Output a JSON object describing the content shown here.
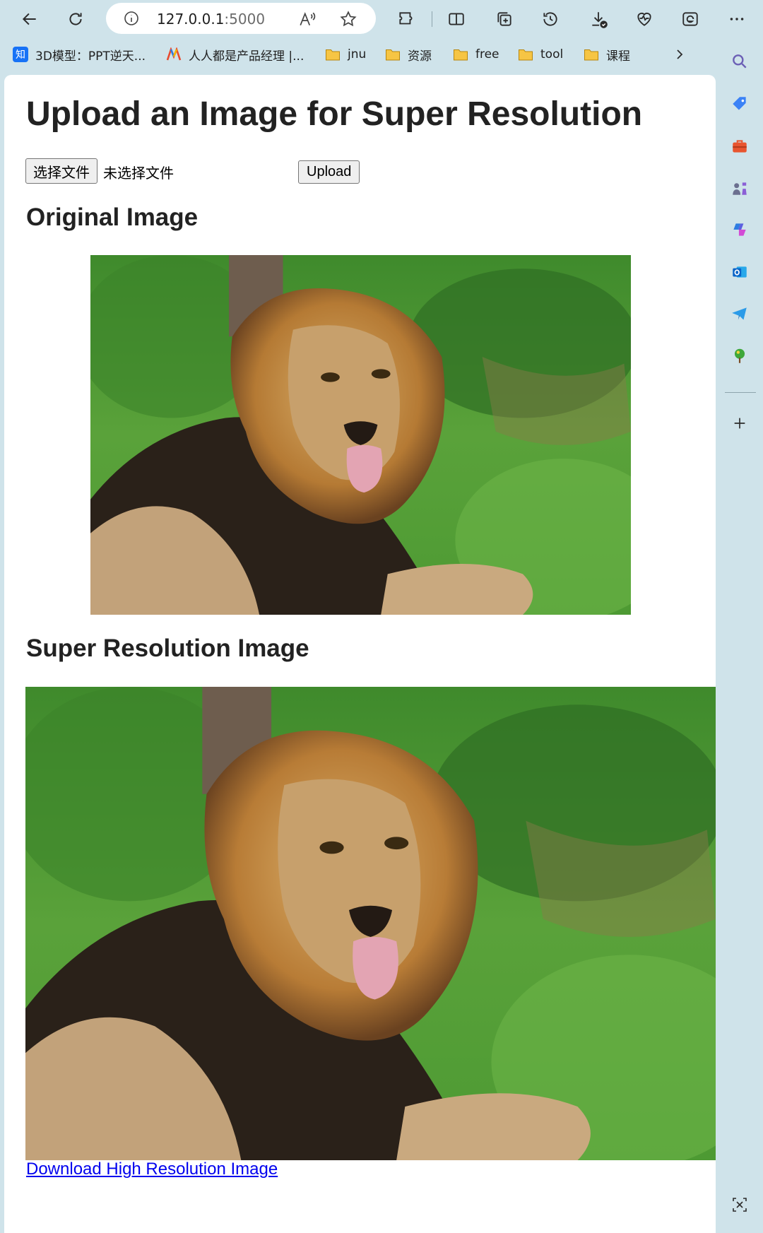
{
  "browser": {
    "url_host": "127.0.0.1",
    "url_port": ":5000",
    "bookmarks": [
      {
        "label": "3D模型：PPT逆天...",
        "icon": "zhihu-icon"
      },
      {
        "label": "人人都是产品经理 |...",
        "icon": "pm-logo-icon"
      },
      {
        "label": "jnu",
        "icon": "folder-icon"
      },
      {
        "label": "资源",
        "icon": "folder-icon"
      },
      {
        "label": "free",
        "icon": "folder-icon"
      },
      {
        "label": "tool",
        "icon": "folder-icon"
      },
      {
        "label": "课程",
        "icon": "folder-icon"
      }
    ],
    "zhihu_badge": "知"
  },
  "page": {
    "title": "Upload an Image for Super Resolution",
    "file_button_label": "选择文件",
    "file_status": "未选择文件",
    "upload_button_label": "Upload",
    "original_heading": "Original Image",
    "sr_heading": "Super Resolution Image",
    "download_link_label": "Download High Resolution Image"
  },
  "colors": {
    "browser_chrome": "#cfe3ea",
    "link": "#0000ee",
    "folder": "#f6c544",
    "heading_text": "#222222"
  }
}
